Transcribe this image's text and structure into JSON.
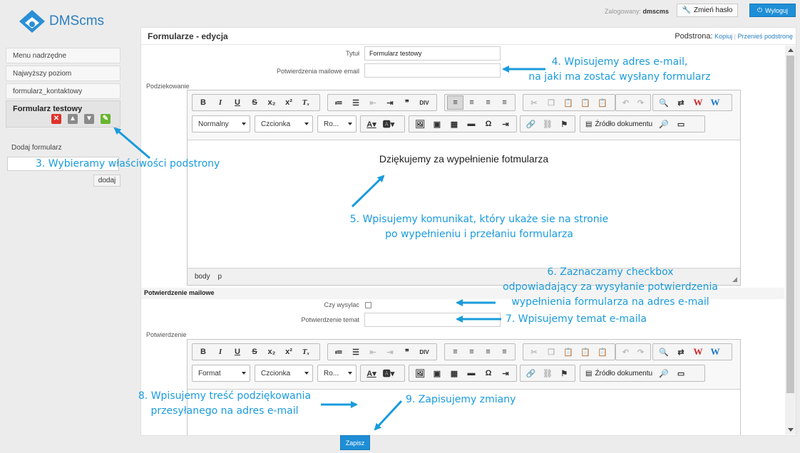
{
  "app": {
    "logo_text": "DMScms"
  },
  "sidebar": {
    "items": [
      {
        "label": "Menu nadrzędne"
      },
      {
        "label": "Najwyższy poziom"
      },
      {
        "label": "formularz_kontaktowy"
      }
    ],
    "active_item": {
      "label": "Formularz testowy",
      "icons": [
        "delete-icon",
        "move-up-icon",
        "move-down-icon",
        "edit-properties-icon"
      ]
    },
    "add_form": {
      "label": "Dodaj formularz",
      "value": "",
      "button": "dodaj"
    }
  },
  "header": {
    "logged_label": "Zalogowany:",
    "username": "dmscms",
    "change_password": "Zmień hasło",
    "logout": "Wyloguj"
  },
  "panel": {
    "title": "Formularze - edycja",
    "subpage_label": "Podstrona:",
    "subpage_links": [
      "Kopiuj",
      "Przenieś podstronę"
    ],
    "fields": {
      "title_label": "Tytuł",
      "title_value": "Formularz testowy",
      "email_label": "Potwierdzenia mailowe email",
      "email_value": "",
      "thanks_label": "Podziekowanie"
    },
    "confirm_section": {
      "heading": "Potwierdzenie mailowe",
      "send_label": "Czy wysylac",
      "send_checked": false,
      "subject_label": "Potwierdzenie temat",
      "subject_value": "",
      "body_label": "Potwierdzenie"
    },
    "save_button": "Zapisz"
  },
  "editor1": {
    "format_combo": "Normalny",
    "font_combo": "Czcionka",
    "size_combo": "Ro...",
    "source_button": "Źródło dokumentu",
    "content": "Dziękujemy za wypełnienie fotmularza",
    "status_path": [
      "body",
      "p"
    ]
  },
  "editor2": {
    "format_combo": "Format",
    "font_combo": "Czcionka",
    "size_combo": "Ro...",
    "source_button": "Źródło dokumentu"
  },
  "annotations": {
    "a3": "3. Wybieramy właściwości podstrony",
    "a4_l1": "4. Wpisujemy adres e-mail,",
    "a4_l2": "na jaki ma zostać wysłany formularz",
    "a5_l1": "5. Wpisujemy komunikat, który ukaże sie na stronie",
    "a5_l2": "po wypełnieniu i przełaniu formularza",
    "a6_l1": "6. Zaznaczamy checkbox",
    "a6_l2": "odpowiadający za wysyłanie potwierdzenia",
    "a6_l3": "wypełnienia formularza na adres e-mail",
    "a7": "7. Wpisujemy temat e-maila",
    "a8_l1": "8. Wpisujemy treść podziękowania",
    "a8_l2": "przesyłanego na adres e-mail",
    "a9": "9. Zapisujemy zmiany"
  },
  "colors": {
    "accent": "#1e8ed6",
    "annotation": "#1a9bdc",
    "delete": "#e0312b",
    "edit": "#6ab52f"
  }
}
